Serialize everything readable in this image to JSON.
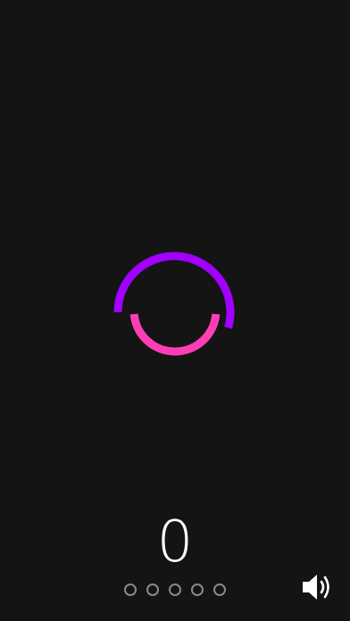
{
  "game": {
    "score": "0",
    "lives_total": 5,
    "lives_filled": 0,
    "sound": "on"
  },
  "colors": {
    "background": "#141414",
    "arc_top": "#a100ff",
    "arc_bottom": "#ff3eb5",
    "life_dot": "#8a8a8a",
    "icon": "#ffffff"
  },
  "icons": {
    "sound_button": "speaker-sound-on-icon"
  }
}
